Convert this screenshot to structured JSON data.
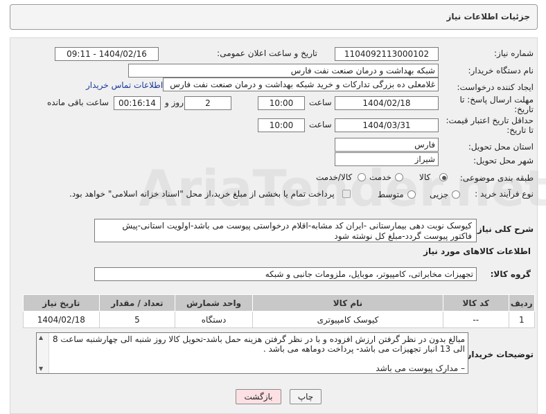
{
  "header": {
    "title": "جزئیات اطلاعات نیاز"
  },
  "watermark": {
    "text": "AriaTender.net"
  },
  "fields": {
    "need_number_label": "شماره نیاز:",
    "need_number": "1104092113000102",
    "announce_label": "تاریخ و ساعت اعلان عمومی:",
    "announce_value": "1404/02/16 - 09:11",
    "buyer_org_label": "نام دستگاه خریدار:",
    "buyer_org": "شبکه بهداشت و درمان صنعت نفت فارس",
    "creator_label": "ایجاد کننده درخواست:",
    "creator": "غلامعلی ده بزرگی تدارکات و خرید شبکه بهداشت و درمان صنعت نفت فارس",
    "contact_link": "اطلاعات تماس خریدار",
    "deadline_label_1": "مهلت ارسال پاسخ: تا",
    "deadline_label_2": "تاریخ:",
    "deadline_date": "1404/02/18",
    "time_word": "ساعت",
    "deadline_time": "10:00",
    "days_value": "2",
    "days_word": "روز و",
    "remaining_time": "00:16:14",
    "remaining_word": "ساعت باقی مانده",
    "price_valid_label_1": "حداقل تاریخ اعتبار قیمت:",
    "price_valid_label_2": "تا تاریخ:",
    "price_valid_date": "1404/03/31",
    "price_valid_time": "10:00",
    "province_label": "استان محل تحویل:",
    "province": "فارس",
    "city_label": "شهر محل تحویل:",
    "city": "شیراز",
    "category_label": "طبقه بندی موضوعی:",
    "category_options": [
      "کالا",
      "خدمت",
      "کالا/خدمت"
    ],
    "process_label": "نوع فرآیند خرید :",
    "process_options": [
      "جزیی",
      "متوسط"
    ],
    "payment_note": "پرداخت تمام یا بخشی از مبلغ خرید،از محل \"اسناد خزانه اسلامی\" خواهد بود.",
    "description_label": "شرح کلی نیاز:",
    "description": "کیوسک نوبت دهی بیمارستانی   -ایران کد مشابه-اقلام درخواستی پیوست می باشد-اولویت استانی-پیش فاکتور پیوست گردد-مبلغ کل نوشته شود"
  },
  "goods_section": {
    "title": "اطلاعات کالاهای مورد نیاز",
    "group_label": "گروه کالا:",
    "group_value": "تجهیزات مخابراتی، کامپیوتر، موبایل، ملزومات جانبی و شبکه",
    "columns": [
      "ردیف",
      "کد کالا",
      "نام کالا",
      "واحد شمارش",
      "تعداد / مقدار",
      "تاریخ نیاز"
    ],
    "rows": [
      [
        "1",
        "--",
        "کیوسک کامپیوتری",
        "دستگاه",
        "5",
        "1404/02/18"
      ]
    ]
  },
  "buyer_notes": {
    "label": "توضیحات خریدار:",
    "lines": [
      "مبالغ بدون در نظر گرفتن ارزش افزوده و با در نظر گرفتن هزینه حمل باشد-تحویل کالا روز شنبه الی چهارشنبه ساعت 8",
      "الی 13 انبار تجهیزات می باشد- پرداخت دوماهه می باشد .",
      "",
      "– مدارک پیوست می باشد"
    ]
  },
  "buttons": {
    "print": "چاپ",
    "back": "بازگشت"
  }
}
